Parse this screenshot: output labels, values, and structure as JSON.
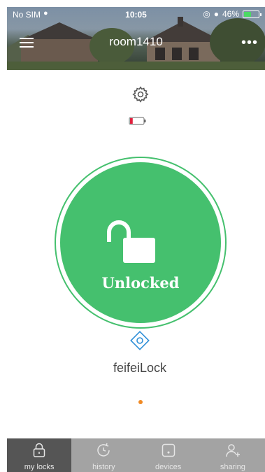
{
  "status_bar": {
    "carrier": "No SIM",
    "time": "10:05",
    "battery_percent": "46%"
  },
  "header": {
    "title": "room1410",
    "menu_icon": "hamburger-menu-icon",
    "more_icon": "more-icon"
  },
  "lock": {
    "state_label": "Unlocked",
    "name": "feifeiLock",
    "battery_level": 0.2,
    "settings_icon": "gear-icon",
    "lock_icon": "unlocked-padlock-icon",
    "type_icon": "diamond-target-icon"
  },
  "tabs": [
    {
      "label": "my locks",
      "icon": "padlock-icon",
      "active": true
    },
    {
      "label": "history",
      "icon": "clock-icon",
      "active": false
    },
    {
      "label": "devices",
      "icon": "device-icon",
      "active": false
    },
    {
      "label": "sharing",
      "icon": "add-user-icon",
      "active": false
    }
  ],
  "colors": {
    "lock_green": "#45c06e",
    "dot_orange": "#f08a24",
    "battery_red": "#e0213e",
    "tabbar_bg": "#a3a3a3",
    "tab_active_bg": "#555555",
    "accent_blue": "#2f8fd8"
  }
}
